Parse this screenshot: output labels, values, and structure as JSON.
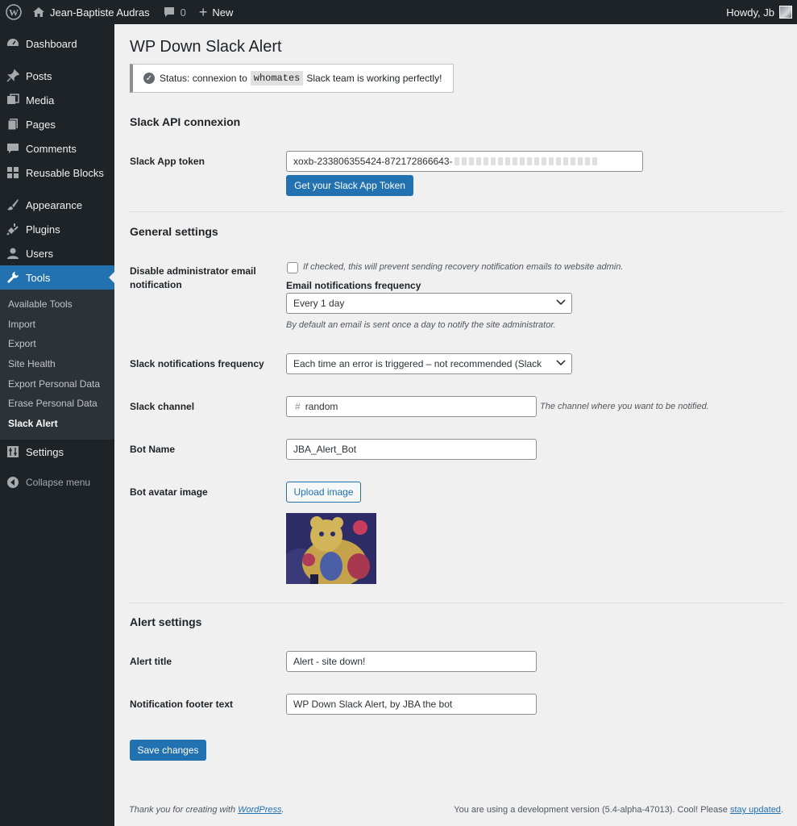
{
  "admin_bar": {
    "site_name": "Jean-Baptiste Audras",
    "comments_count": "0",
    "new_label": "New",
    "howdy": "Howdy, Jb"
  },
  "menu": {
    "dashboard": "Dashboard",
    "posts": "Posts",
    "media": "Media",
    "pages": "Pages",
    "comments": "Comments",
    "reusable_blocks": "Reusable Blocks",
    "appearance": "Appearance",
    "plugins": "Plugins",
    "users": "Users",
    "tools": "Tools",
    "tools_submenu": [
      "Available Tools",
      "Import",
      "Export",
      "Site Health",
      "Export Personal Data",
      "Erase Personal Data",
      "Slack Alert"
    ],
    "settings": "Settings",
    "collapse": "Collapse menu"
  },
  "page": {
    "title": "WP Down Slack Alert",
    "notice_prefix": "Status: connexion to",
    "notice_team": "whomates",
    "notice_suffix": "Slack team is working perfectly!"
  },
  "api": {
    "section_title": "Slack API connexion",
    "token_label": "Slack App token",
    "token_value": "xoxb-233806355424-872172866643-",
    "get_token_button": "Get your Slack App Token"
  },
  "general": {
    "section_title": "General settings",
    "disable_label": "Disable administrator email notification",
    "disable_desc": "If checked, this will prevent sending recovery notification emails to website admin.",
    "email_freq_label": "Email notifications frequency",
    "email_freq_value": "Every 1 day",
    "email_freq_desc": "By default an email is sent once a day to notify the site administrator.",
    "slack_freq_label": "Slack notifications frequency",
    "slack_freq_value": "Each time an error is triggered – not recommended (Slack",
    "channel_label": "Slack channel",
    "channel_prefix": "#",
    "channel_value": "random",
    "channel_desc": "The channel where you want to be notified.",
    "bot_name_label": "Bot Name",
    "bot_name_value": "JBA_Alert_Bot",
    "avatar_label": "Bot avatar image",
    "upload_button": "Upload image"
  },
  "alert": {
    "section_title": "Alert settings",
    "title_label": "Alert title",
    "title_value": "Alert - site down!",
    "footer_label": "Notification footer text",
    "footer_value": "WP Down Slack Alert, by JBA the bot"
  },
  "save_button": "Save changes",
  "footer": {
    "thanks_prefix": "Thank you for creating with",
    "thanks_link": "WordPress",
    "thanks_suffix": ".",
    "version_text": "You are using a development version (5.4-alpha-47013). Cool! Please",
    "version_link": "stay updated",
    "version_suffix": "."
  },
  "colors": {
    "accent": "#2271b1",
    "sidebar": "#1d2327",
    "background": "#f0f0f1"
  }
}
